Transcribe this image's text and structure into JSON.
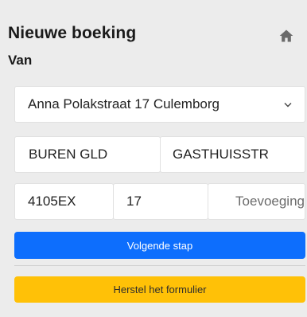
{
  "header": {
    "title": "Nieuwe boeking",
    "subtitle": "Van",
    "home_icon": "home-icon"
  },
  "form": {
    "address_select": {
      "value": "Anna Polakstraat 17 Culemborg",
      "icon": "chevron-down-icon"
    },
    "city": "BUREN GLD",
    "street": "GASTHUISSTR",
    "postal_code": "4105EX",
    "house_number": "17",
    "addition": {
      "value": "",
      "placeholder": "Toevoeging"
    },
    "next_button": "Volgende stap",
    "reset_button": "Herstel het formulier"
  },
  "colors": {
    "background": "#ececec",
    "primary": "#0d6efd",
    "warning": "#ffc107",
    "field_bg": "#ffffff"
  }
}
